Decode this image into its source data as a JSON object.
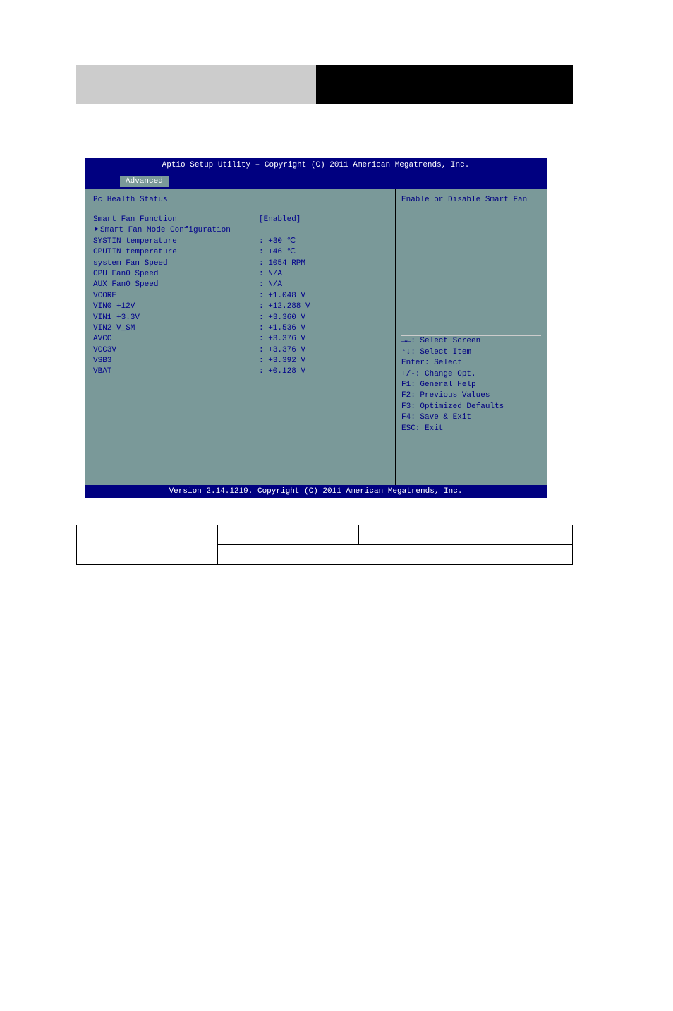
{
  "header": {
    "title": "Aptio Setup Utility – Copyright (C) 2011 American Megatrends, Inc.",
    "tab": "Advanced",
    "footer": "Version 2.14.1219. Copyright (C) 2011 American Megatrends, Inc."
  },
  "section_title": "Pc Health Status",
  "selected": {
    "label": "Smart Fan Function",
    "value": "[Enabled]"
  },
  "submenu": "Smart Fan Mode Configuration",
  "readings": [
    {
      "label": "SYSTIN temperature",
      "value": ": +30 ℃"
    },
    {
      "label": "CPUTIN temperature",
      "value": ": +46 ℃"
    },
    {
      "label": "system Fan Speed",
      "value": ": 1054 RPM"
    },
    {
      "label": "CPU Fan0 Speed",
      "value": ": N/A"
    },
    {
      "label": "AUX Fan0 Speed",
      "value": ": N/A"
    },
    {
      "label": "VCORE",
      "value": ": +1.048 V"
    },
    {
      "label": "VIN0 +12V",
      "value": ": +12.288 V"
    },
    {
      "label": "VIN1 +3.3V",
      "value": ": +3.360 V"
    },
    {
      "label": "VIN2 V_SM",
      "value": ": +1.536 V"
    },
    {
      "label": "AVCC",
      "value": ": +3.376 V"
    },
    {
      "label": "VCC3V",
      "value": ": +3.376 V"
    },
    {
      "label": "VSB3",
      "value": ": +3.392 V"
    },
    {
      "label": "VBAT",
      "value": ": +0.128 V"
    }
  ],
  "help_text": "Enable or Disable Smart Fan",
  "help_keys": [
    "→←: Select Screen",
    "↑↓: Select Item",
    "Enter: Select",
    "+/-: Change Opt.",
    "F1: General Help",
    "F2: Previous Values",
    "F3: Optimized Defaults",
    "F4: Save & Exit",
    "ESC: Exit"
  ]
}
